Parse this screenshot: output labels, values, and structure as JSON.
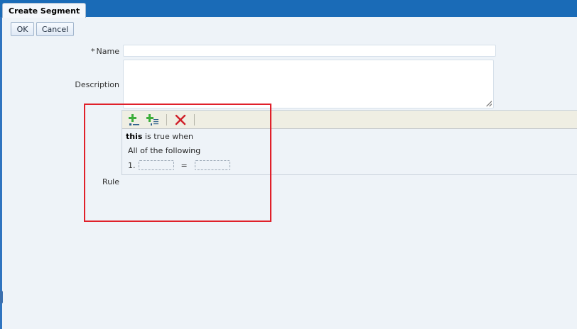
{
  "window": {
    "tab_title": "Create Segment"
  },
  "toolbar": {
    "ok_label": "OK",
    "cancel_label": "Cancel"
  },
  "form": {
    "name": {
      "required_marker": "*",
      "label": "Name",
      "value": ""
    },
    "description": {
      "label": "Description",
      "value": ""
    },
    "rule": {
      "label": "Rule",
      "toolbar_icons": [
        "add-condition-icon",
        "add-group-icon",
        "delete-icon"
      ],
      "subject": "this",
      "condition_text": "is true when",
      "group_label": "All of the following",
      "conditions": [
        {
          "index": "1.",
          "operator": "=",
          "left": "",
          "right": ""
        }
      ]
    }
  },
  "colors": {
    "title_bar": "#1a6bb7",
    "background": "#eef3f8",
    "highlight_border": "#e0202a"
  }
}
